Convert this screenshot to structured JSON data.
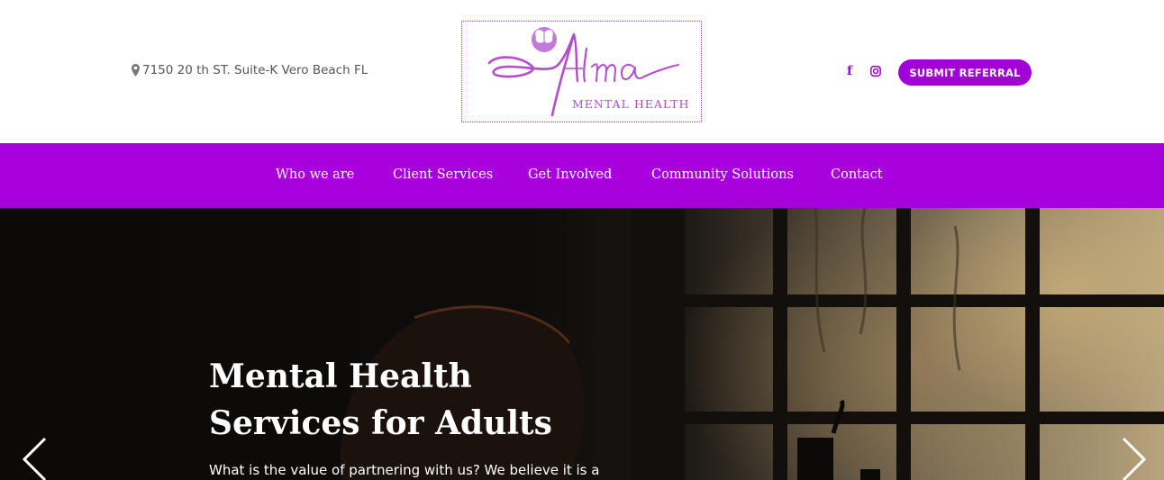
{
  "header": {
    "address": "7150 20 th ST. Suite-K Vero Beach FL",
    "address_icon": "map-pin-icon",
    "logo": {
      "name": "Alma",
      "subtitle": "MENTAL HEALTH"
    },
    "social": {
      "facebook_icon": "facebook-icon",
      "instagram_icon": "instagram-icon"
    },
    "submit_referral_label": "SUBMIT REFERRAL"
  },
  "nav": {
    "items": [
      {
        "label": "Who we are"
      },
      {
        "label": "Client Services"
      },
      {
        "label": "Get Involved"
      },
      {
        "label": "Community Solutions"
      },
      {
        "label": "Contact"
      }
    ]
  },
  "hero": {
    "title_line1": "Mental Health",
    "title_line2": "Services for Adults",
    "text": "What is the value of partnering with us? We believe it is a",
    "prev_icon": "chevron-left-icon",
    "next_icon": "chevron-right-icon"
  },
  "colors": {
    "brand_purple": "#a800dc",
    "button_purple": "#a100d6",
    "logo_purple": "#b44dcc"
  }
}
